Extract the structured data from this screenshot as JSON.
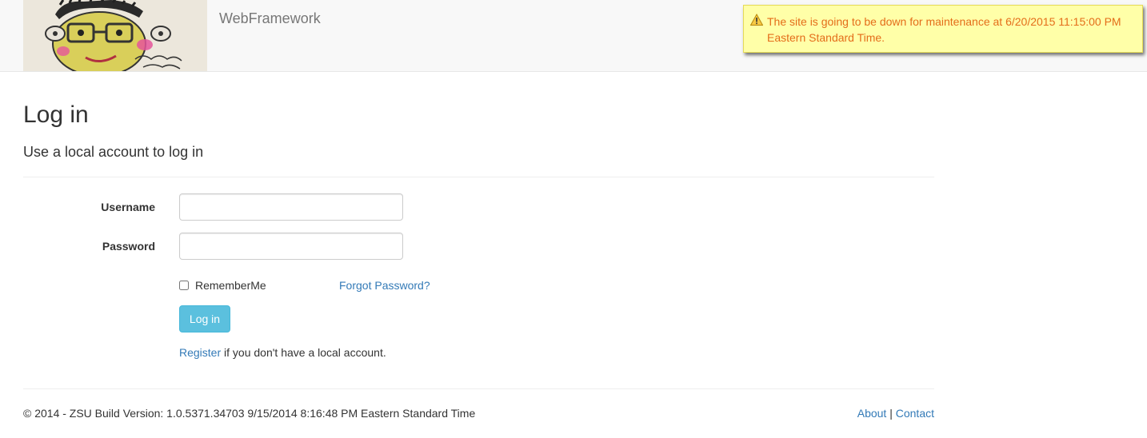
{
  "header": {
    "brand": "WebFramework",
    "logo_icon": "cartoon-face-drawing",
    "notice": {
      "icon": "warning-icon",
      "text": "The site is going to be down for maintenance at 6/20/2015 11:15:00 PM Eastern Standard Time."
    }
  },
  "main": {
    "title": "Log in",
    "subtitle": "Use a local account to log in",
    "form": {
      "username_label": "Username",
      "username_value": "",
      "password_label": "Password",
      "password_value": "",
      "remember_label": "RememberMe",
      "remember_checked": false,
      "forgot_link": "Forgot Password?",
      "login_button": "Log in",
      "register_link": "Register",
      "register_suffix": " if you don't have a local account."
    }
  },
  "footer": {
    "text": "© 2014 - ZSU Build Version: 1.0.5371.34703 9/15/2014 8:16:48 PM Eastern Standard Time",
    "about_link": "About",
    "separator": "|",
    "contact_link": "Contact"
  },
  "colors": {
    "link": "#337ab7",
    "button": "#5bc0de",
    "notice_bg": "#ffffa8",
    "notice_text": "#e46d1a"
  }
}
